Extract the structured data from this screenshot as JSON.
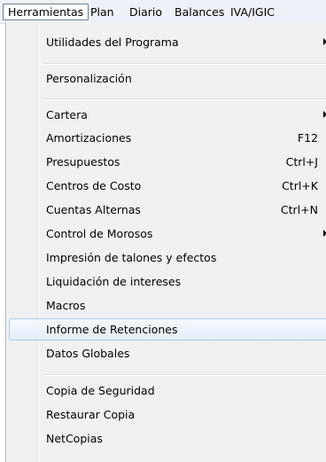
{
  "menubar": {
    "items": [
      "Herramientas",
      "Plan",
      "Diario",
      "Balances",
      "IVA/IGIC"
    ]
  },
  "menu": {
    "items": [
      {
        "label": "Utilidades del Programa",
        "shortcut": "",
        "submenu": true
      },
      {
        "label": "Personalización",
        "shortcut": "",
        "submenu": false
      },
      {
        "label": "Cartera",
        "shortcut": "",
        "submenu": true
      },
      {
        "label": "Amortizaciones",
        "shortcut": "F12",
        "submenu": false
      },
      {
        "label": "Presupuestos",
        "shortcut": "Ctrl+J",
        "submenu": false
      },
      {
        "label": "Centros de Costo",
        "shortcut": "Ctrl+K",
        "submenu": false
      },
      {
        "label": "Cuentas Alternas",
        "shortcut": "Ctrl+N",
        "submenu": false
      },
      {
        "label": "Control de Morosos",
        "shortcut": "",
        "submenu": true
      },
      {
        "label": "Impresión de talones y efectos",
        "shortcut": "",
        "submenu": false
      },
      {
        "label": "Liquidación de intereses",
        "shortcut": "",
        "submenu": false
      },
      {
        "label": "Macros",
        "shortcut": "",
        "submenu": false
      },
      {
        "label": "Informe de Retenciones",
        "shortcut": "",
        "submenu": false,
        "highlighted": true
      },
      {
        "label": "Datos Globales",
        "shortcut": "",
        "submenu": false
      },
      {
        "label": "Copia de Seguridad",
        "shortcut": "",
        "submenu": false
      },
      {
        "label": "Restaurar Copia",
        "shortcut": "",
        "submenu": false
      },
      {
        "label": "NetCopias",
        "shortcut": "",
        "submenu": false
      }
    ]
  }
}
